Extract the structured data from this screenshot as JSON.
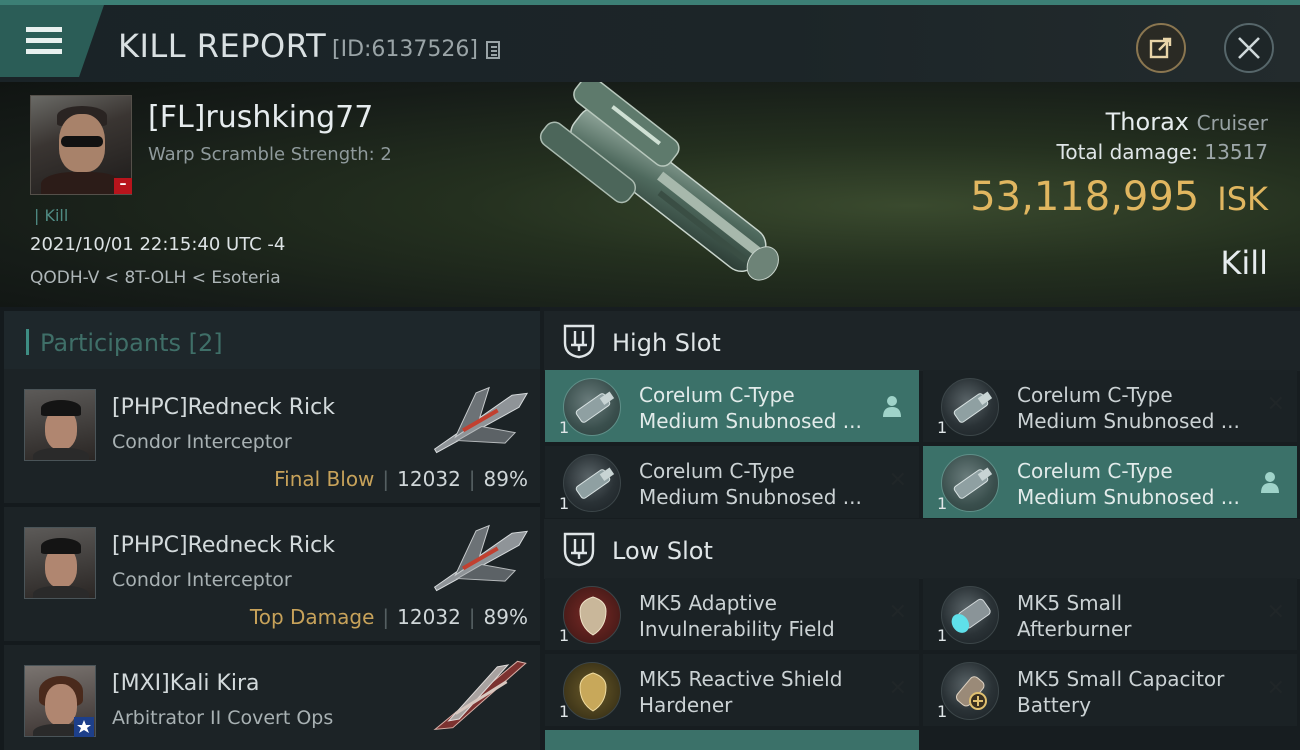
{
  "header": {
    "title": "KILL REPORT",
    "report_id": "[ID:6137526]",
    "share_icon": "share-icon",
    "close_icon": "close-icon"
  },
  "victim": {
    "name": "[FL]rushking77",
    "warp": "Warp Scramble Strength: 2",
    "kill_tag": "Kill",
    "datetime": "2021/10/01 22:15:40 UTC -4",
    "location": "QODH-V < 8T-OLH < Esoteria",
    "ship": "Thorax",
    "ship_class": "Cruiser",
    "total_damage_label": "Total damage:",
    "total_damage": "13517",
    "isk_value": "53,118,995",
    "isk_unit": "ISK",
    "result": "Kill"
  },
  "participants": {
    "label": "Participants",
    "count": "[2]",
    "rows": [
      {
        "name": "[PHPC]Redneck Rick",
        "ship": "Condor Interceptor",
        "tag": "Final Blow",
        "damage": "12032",
        "percent": "89%"
      },
      {
        "name": "[PHPC]Redneck Rick",
        "ship": "Condor Interceptor",
        "tag": "Top Damage",
        "damage": "12032",
        "percent": "89%"
      },
      {
        "name": "[MXI]Kali Kira",
        "ship": "Arbitrator II Covert Ops",
        "tag": "",
        "damage": "",
        "percent": ""
      }
    ]
  },
  "slots": {
    "high": {
      "title": "High Slot",
      "modules": [
        {
          "name": "Corelum C-Type\nMedium Snubnosed ...",
          "qty": "1"
        },
        {
          "name": "Corelum C-Type\nMedium Snubnosed ...",
          "qty": "1"
        },
        {
          "name": "Corelum C-Type\nMedium Snubnosed ...",
          "qty": "1"
        },
        {
          "name": "Corelum C-Type\nMedium Snubnosed ...",
          "qty": "1"
        }
      ]
    },
    "low": {
      "title": "Low Slot",
      "modules": [
        {
          "name": "MK5 Adaptive\nInvulnerability Field",
          "qty": "1"
        },
        {
          "name": "MK5 Small\nAfterburner",
          "qty": "1"
        },
        {
          "name": "MK5 Reactive Shield\nHardener",
          "qty": "1"
        },
        {
          "name": "MK5 Small Capacitor\nBattery",
          "qty": "1"
        }
      ]
    }
  },
  "colors": {
    "accent": "#3e8d83",
    "selected_module": "#3b7169",
    "isk_gold": "#e0b660",
    "tag_gold": "#c7a25a"
  }
}
